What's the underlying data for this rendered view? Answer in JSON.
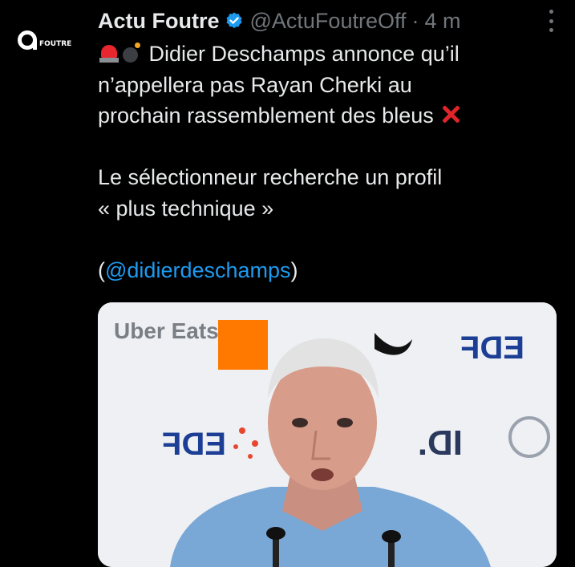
{
  "author": {
    "avatar_text": "FOUTRE",
    "name": "Actu Foutre",
    "handle": "@ActuFoutreOff",
    "separator": "·",
    "time": "4 m"
  },
  "tweet": {
    "line1": "Didier Deschamps annonce qu’il",
    "line2": "n’appellera pas Rayan Cherki au",
    "line3": "prochain rassemblement des bleus",
    "line4": "Le sélectionneur recherche un profil",
    "line5": "« plus technique »",
    "mention_open": "(",
    "mention": "@didierdeschamps",
    "mention_close": ")"
  },
  "media": {
    "backdrop_text_1": "Uber Eats",
    "backdrop_text_2": "EDF",
    "backdrop_text_3": "ID.",
    "backdrop_text_4": "EDF"
  },
  "colors": {
    "background": "#000000",
    "text": "#e7e9ea",
    "muted": "#71767b",
    "link": "#1d9bf0",
    "verified": "#1d9bf0",
    "orange_logo": "#ff7900"
  },
  "icons": [
    "verified-badge-icon",
    "more-options-icon",
    "siren-emoji",
    "bomb-emoji",
    "cross-mark-emoji"
  ]
}
